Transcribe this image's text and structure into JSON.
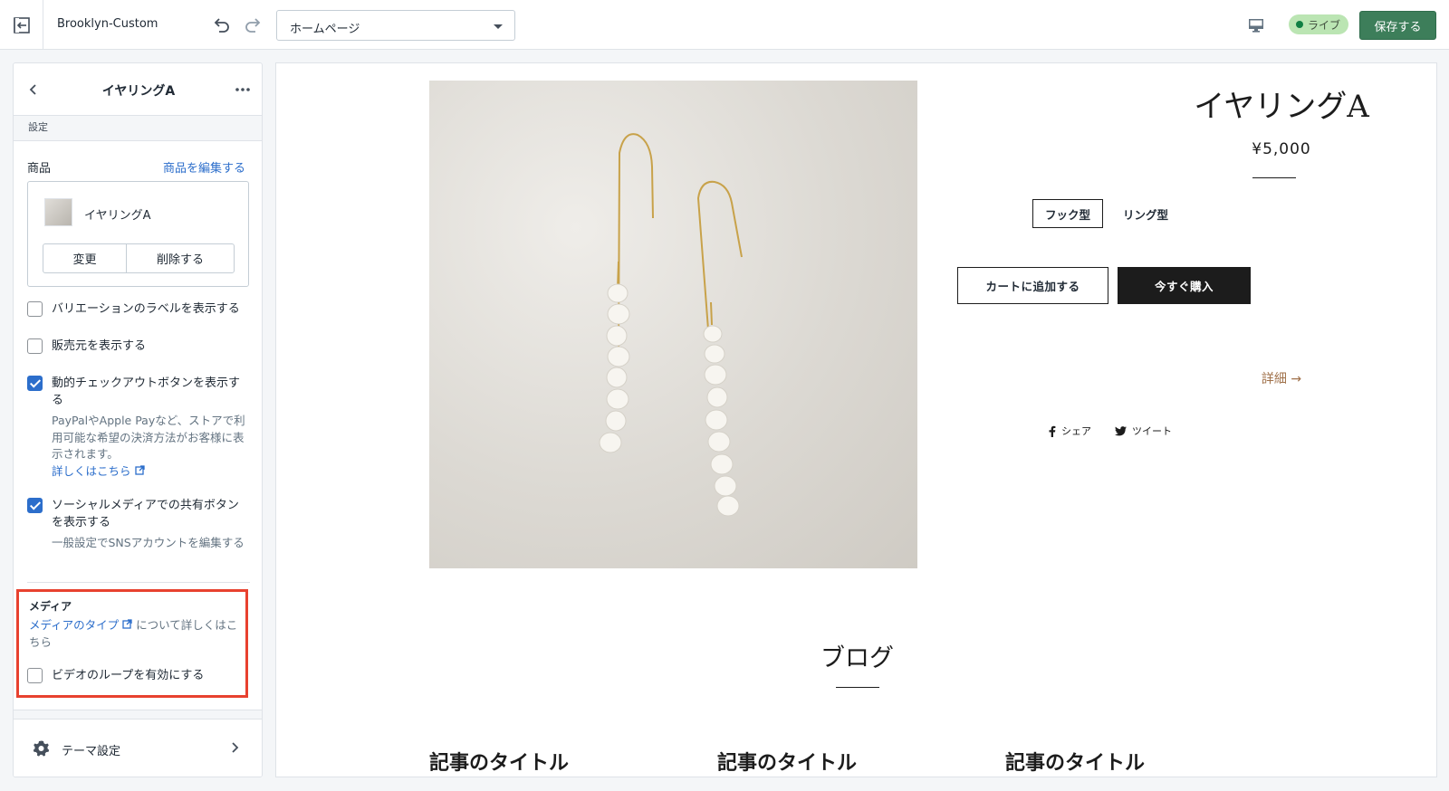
{
  "topbar": {
    "theme_name": "Brooklyn-Custom",
    "page_select": "ホームページ",
    "live_label": "ライブ",
    "save_label": "保存する"
  },
  "sidebar": {
    "title": "イヤリングA",
    "section_label": "設定",
    "product_label": "商品",
    "product_edit_link": "商品を編集する",
    "product_name": "イヤリングA",
    "change_label": "変更",
    "remove_label": "削除する",
    "options": [
      {
        "label": "バリエーションのラベルを表示する",
        "checked": false
      },
      {
        "label": "販売元を表示する",
        "checked": false
      },
      {
        "label": "動的チェックアウトボタンを表示する",
        "checked": true,
        "help": "PayPalやApple Payなど、ストアで利用可能な希望の決済方法がお客様に表示されます。",
        "help_link": "詳しくはこちら"
      },
      {
        "label": "ソーシャルメディアでの共有ボタンを表示する",
        "checked": true,
        "help": "一般設定でSNSアカウントを編集する"
      }
    ],
    "media": {
      "title": "メディア",
      "link": "メディアのタイプ",
      "text_after": "について詳しくはこちら",
      "loop_label": "ビデオのループを有効にする",
      "loop_checked": false
    },
    "footer_label": "テーマ設定"
  },
  "preview": {
    "product_title": "イヤリングA",
    "price": "¥5,000",
    "variants": [
      "フック型",
      "リング型"
    ],
    "add_to_cart": "カートに追加する",
    "buy_now": "今すぐ購入",
    "details": "詳細 →",
    "share": "シェア",
    "tweet": "ツイート",
    "blog_title": "ブログ",
    "articles": [
      "記事のタイトル",
      "記事のタイトル",
      "記事のタイトル"
    ]
  },
  "colors": {
    "accent": "#2c6ecb",
    "save_button": "#3d7e5a",
    "highlight_border": "#e8412f",
    "live_badge": "#bbe5b3",
    "details_link": "#a0714a"
  }
}
